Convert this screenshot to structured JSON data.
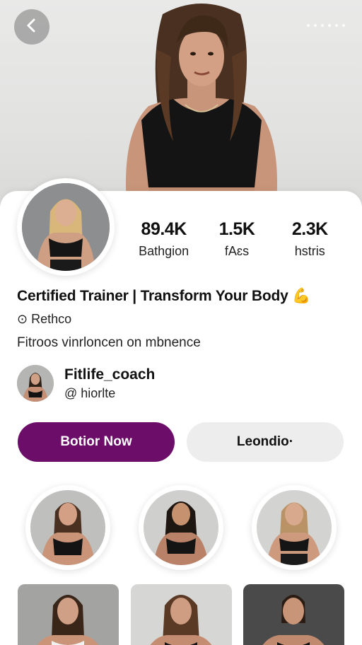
{
  "header": {
    "back_icon": "chevron-left-icon",
    "pagination_dots": 6,
    "active_dot": 4
  },
  "profile": {
    "stats": [
      {
        "value": "89.4K",
        "label": "Bathgion"
      },
      {
        "value": "1.5K",
        "label": "fAɛs"
      },
      {
        "value": "2.3K",
        "label": "hstris"
      }
    ],
    "headline": "Certified Trainer | Transform Your Body",
    "headline_emoji": "💪",
    "location_icon": "pin-icon",
    "location": "Rethco",
    "bio": "Fitroos vinrloncen on mbnence",
    "username": "Fitlife_coach",
    "handle": "@ hiorlte"
  },
  "actions": {
    "primary_label": "Botior Now",
    "secondary_label": "Leondio·"
  },
  "colors": {
    "primary": "#6c0d6a",
    "secondary_bg": "#ededee",
    "background": "#ffffff"
  }
}
